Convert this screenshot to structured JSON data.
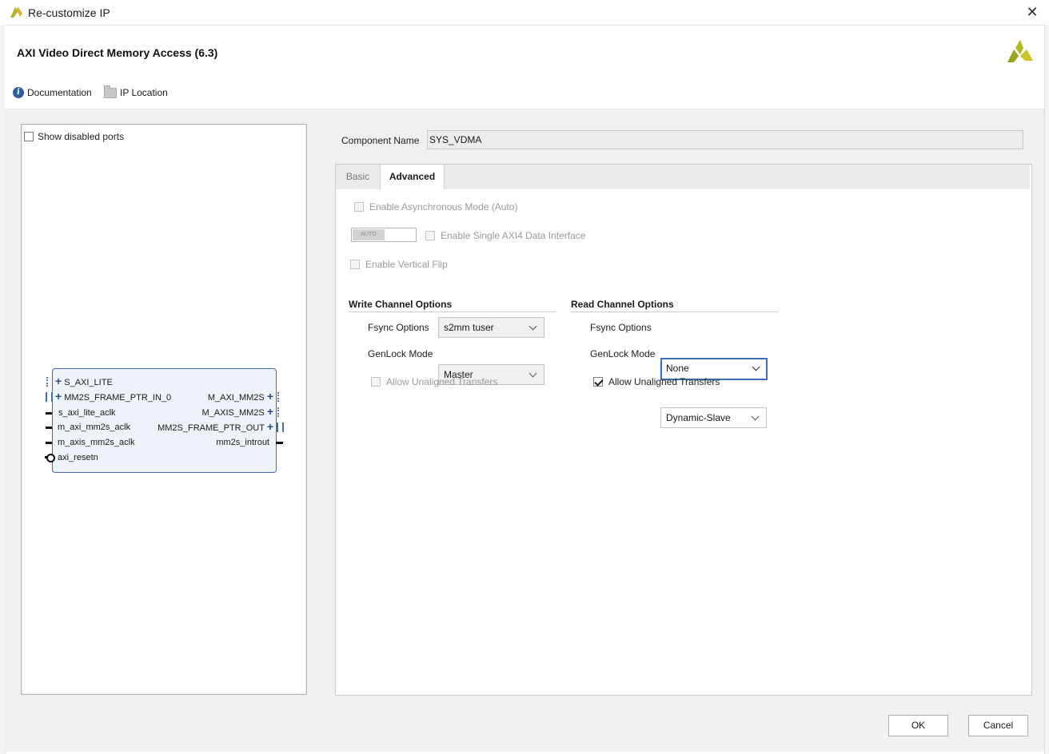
{
  "window": {
    "title": "Re-customize IP",
    "close_glyph": "✕"
  },
  "header": {
    "ip_title": "AXI Video Direct Memory Access (6.3)",
    "documentation_label": "Documentation",
    "ip_location_label": "IP Location"
  },
  "left_panel": {
    "show_disabled_label": "Show disabled ports",
    "show_disabled_checked": false,
    "ports_left": [
      "S_AXI_LITE",
      "MM2S_FRAME_PTR_IN_0",
      "s_axi_lite_aclk",
      "m_axi_mm2s_aclk",
      "m_axis_mm2s_aclk",
      "axi_resetn"
    ],
    "ports_right": [
      "M_AXI_MM2S",
      "M_AXIS_MM2S",
      "MM2S_FRAME_PTR_OUT",
      "mm2s_introut"
    ]
  },
  "component": {
    "label": "Component Name",
    "value": "SYS_VDMA"
  },
  "tabs": [
    {
      "label": "Basic",
      "active": false
    },
    {
      "label": "Advanced",
      "active": true
    }
  ],
  "advanced": {
    "async_mode_label": "Enable Asynchronous Mode (Auto)",
    "auto_toggle_text": "AUTO",
    "single_axi4_label": "Enable Single AXI4 Data Interface",
    "vertical_flip_label": "Enable Vertical Flip",
    "write": {
      "heading": "Write Channel Options",
      "fsync_label": "Fsync Options",
      "fsync_value": "s2mm tuser",
      "genlock_label": "GenLock Mode",
      "genlock_value": "Master",
      "unaligned_label": "Allow Unaligned Transfers",
      "unaligned_checked": false
    },
    "read": {
      "heading": "Read Channel Options",
      "fsync_label": "Fsync Options",
      "fsync_value": "None",
      "genlock_label": "GenLock Mode",
      "genlock_value": "Dynamic-Slave",
      "unaligned_label": "Allow Unaligned Transfers",
      "unaligned_checked": true
    }
  },
  "footer": {
    "ok_label": "OK",
    "cancel_label": "Cancel"
  },
  "colors": {
    "accent": "#3c6fb4",
    "logo": "#9aa21f"
  }
}
